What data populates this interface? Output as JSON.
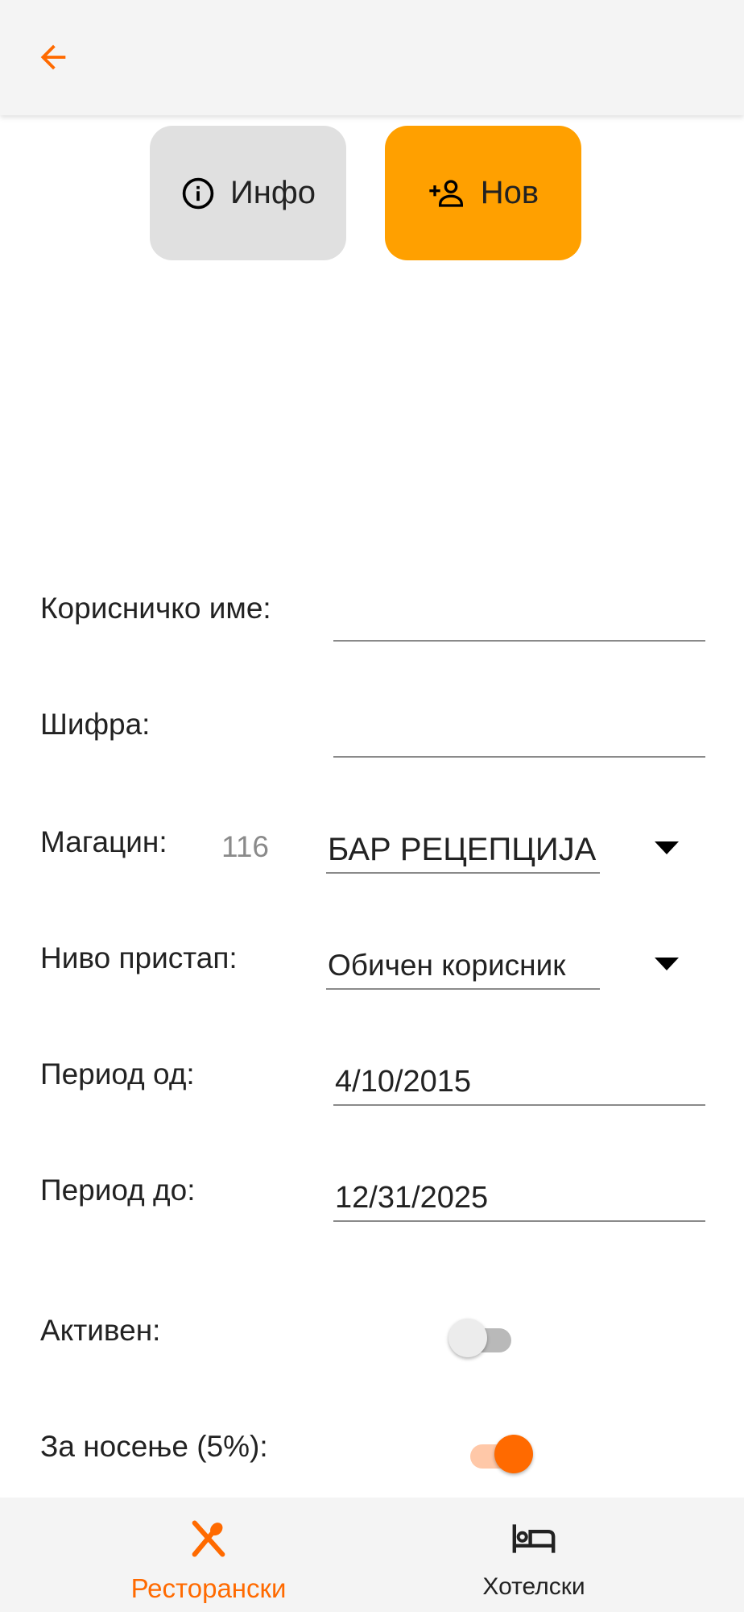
{
  "header": {
    "back_icon": "arrow-left-icon",
    "accent": "#ff6a00"
  },
  "tabs": [
    {
      "label": "Инфо",
      "icon": "info-icon",
      "color": "#e0e0e0"
    },
    {
      "label": "Нов",
      "icon": "person-add-icon",
      "color": "#ffa000"
    }
  ],
  "form": {
    "username": {
      "label": "Корисничко име:",
      "value": ""
    },
    "password": {
      "label": "Шифра:",
      "value": ""
    },
    "warehouse": {
      "label": "Магацин:",
      "code": "116",
      "selected": "БАР РЕЦЕПЦИЈА"
    },
    "access_level": {
      "label": "Ниво пристап:",
      "selected": "Обичен корисник"
    },
    "period_from": {
      "label": "Период од:",
      "value": "4/10/2015"
    },
    "period_to": {
      "label": "Период до:",
      "value": "12/31/2025"
    },
    "active": {
      "label": "Активен:",
      "on": false
    },
    "takeaway": {
      "label": "За носење (5%):",
      "on": true
    }
  },
  "bottom_nav": [
    {
      "label": "Ресторански",
      "icon": "utensils-icon",
      "active": true
    },
    {
      "label": "Хотелски",
      "icon": "bed-icon",
      "active": false
    }
  ]
}
